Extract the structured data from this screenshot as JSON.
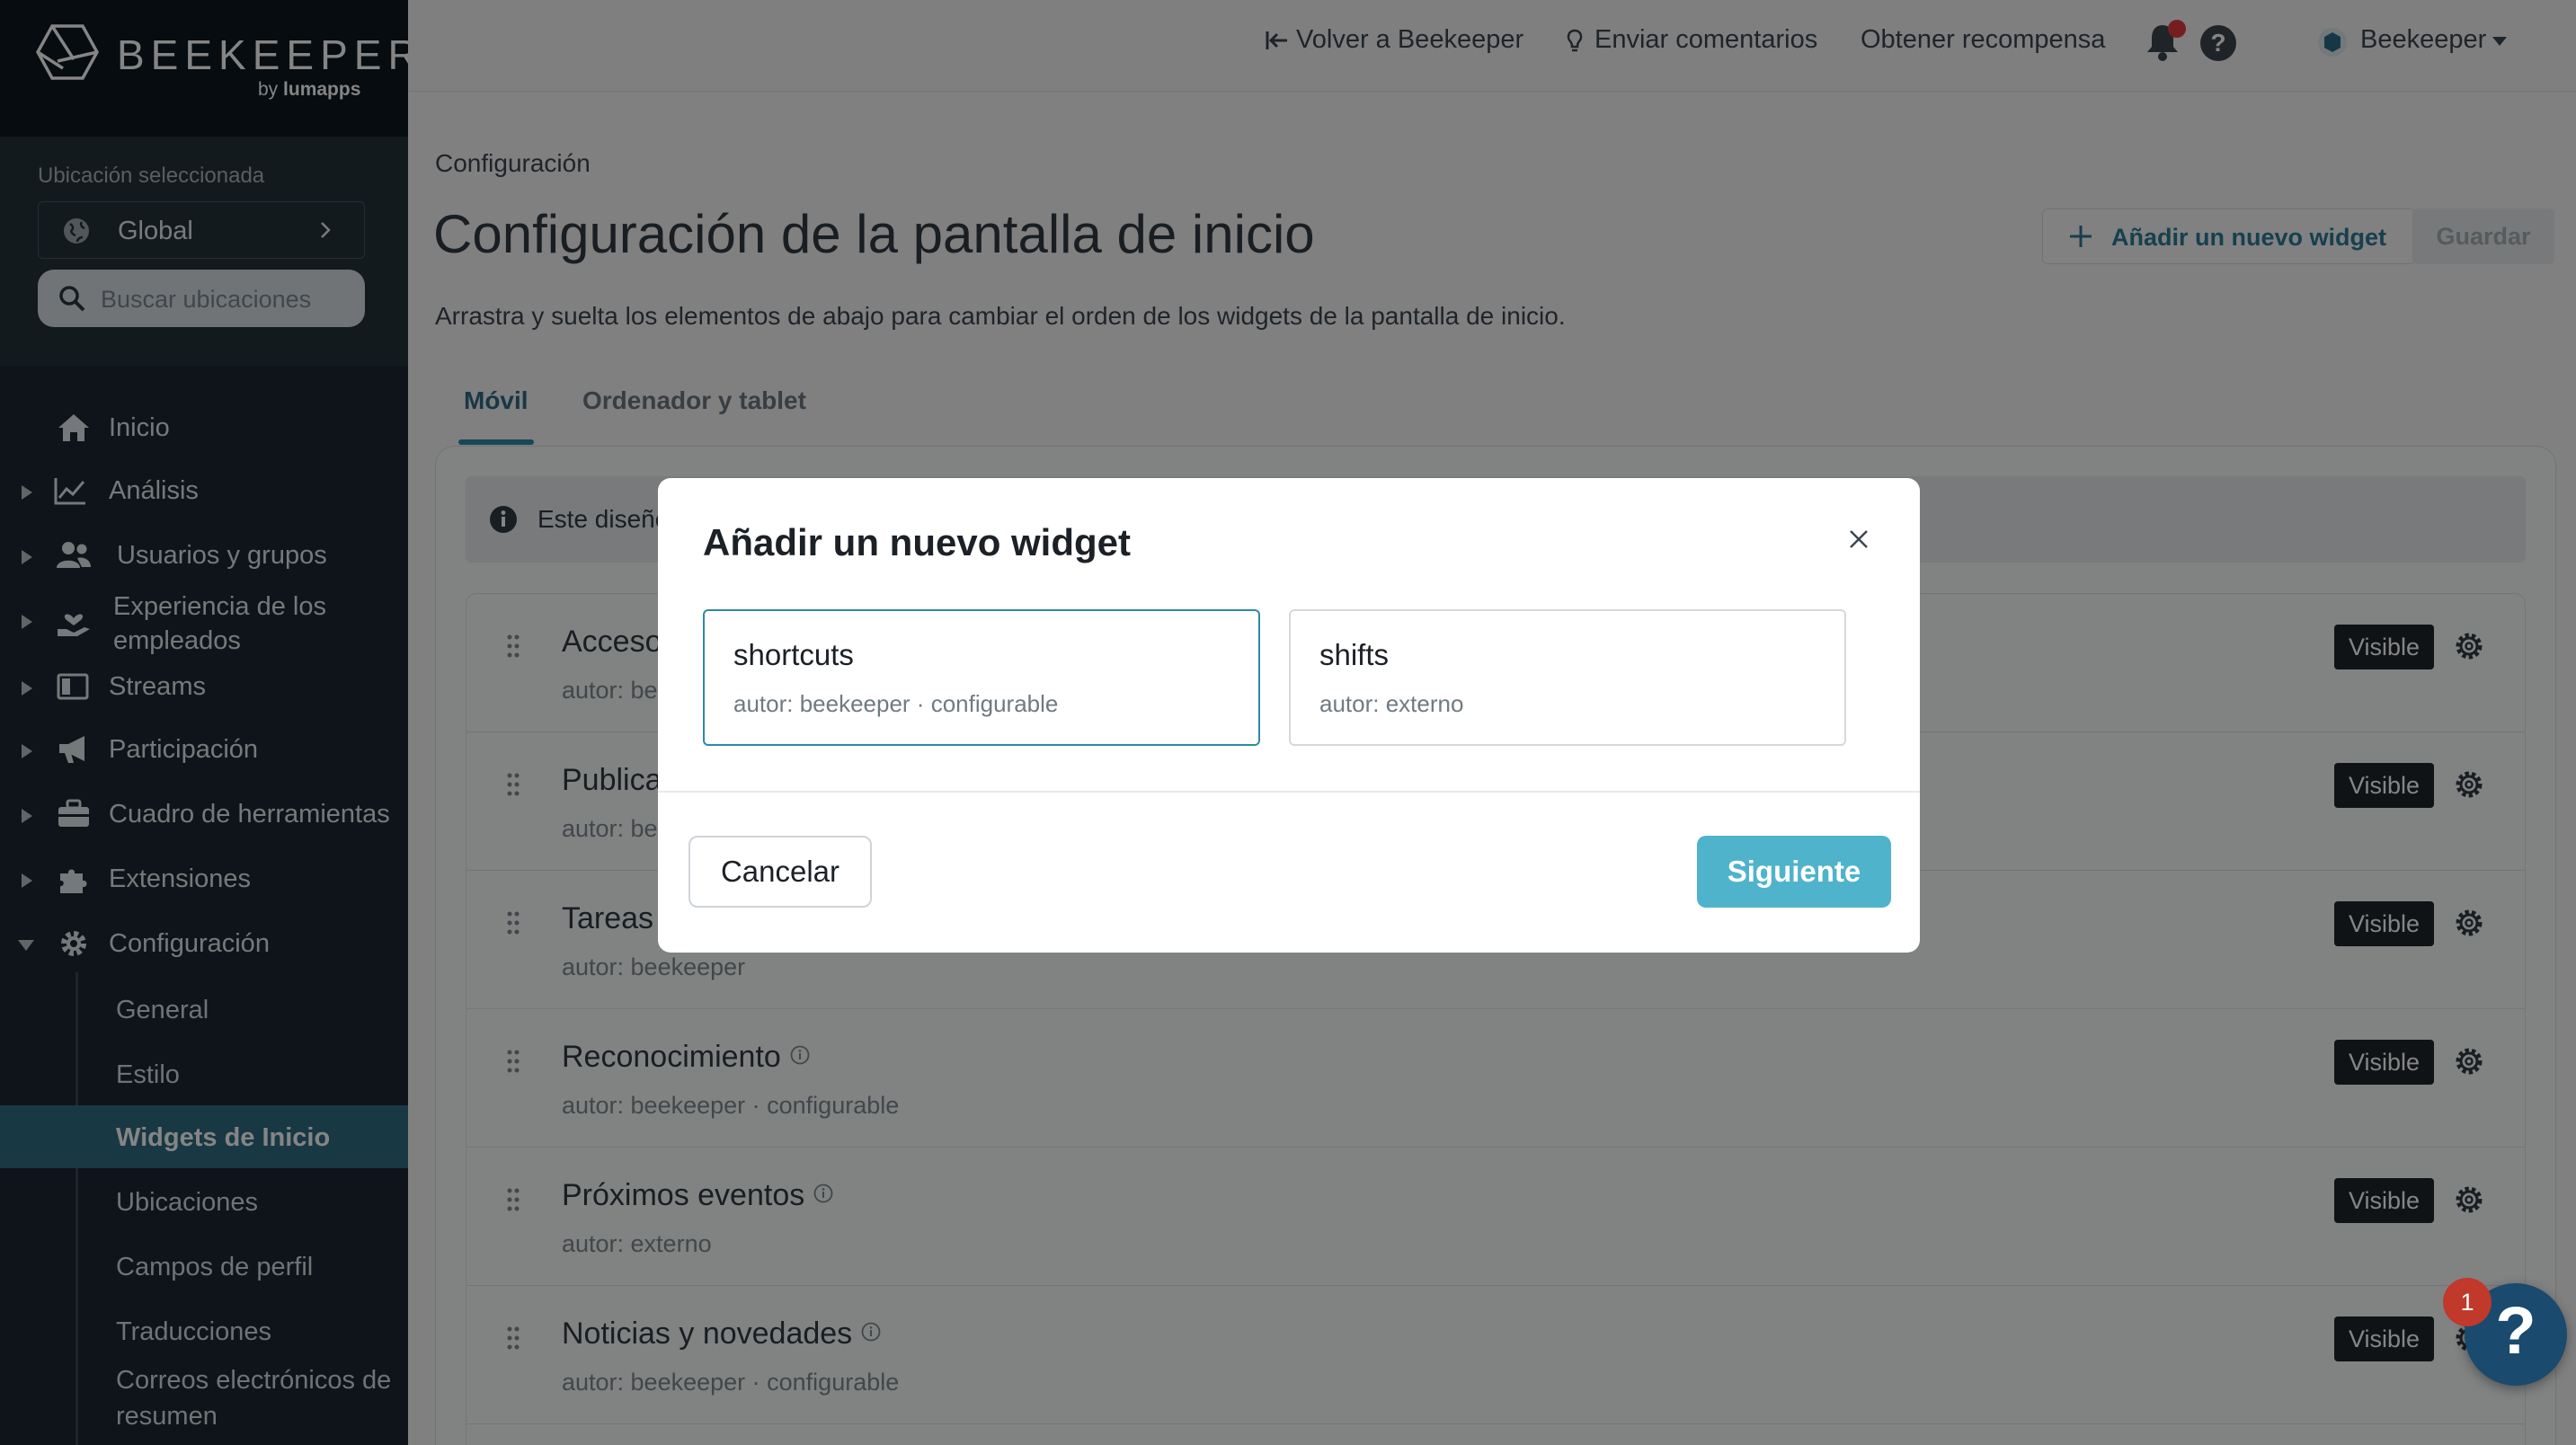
{
  "brand": {
    "name": "BEEKEEPER",
    "by_prefix": "by",
    "by_brand": "lumapps"
  },
  "location": {
    "label": "Ubicación seleccionada",
    "value": "Global",
    "search_placeholder": "Buscar ubicaciones"
  },
  "sidebar": {
    "items": [
      {
        "label": "Inicio",
        "icon": "home-icon",
        "expandable": false
      },
      {
        "label": "Análisis",
        "icon": "chart-line-icon",
        "expandable": true
      },
      {
        "label": "Usuarios y grupos",
        "icon": "users-icon",
        "expandable": true
      },
      {
        "label": "Experiencia de los empleados",
        "icon": "hand-heart-icon",
        "expandable": true
      },
      {
        "label": "Streams",
        "icon": "streams-icon",
        "expandable": true
      },
      {
        "label": "Participación",
        "icon": "megaphone-icon",
        "expandable": true
      },
      {
        "label": "Cuadro de herramientas",
        "icon": "toolbox-icon",
        "expandable": true
      },
      {
        "label": "Extensiones",
        "icon": "puzzle-icon",
        "expandable": true
      },
      {
        "label": "Configuración",
        "icon": "gear-icon",
        "expandable": true,
        "expanded": true
      }
    ],
    "subitems": [
      {
        "label": "General"
      },
      {
        "label": "Estilo"
      },
      {
        "label": "Widgets de Inicio",
        "active": true
      },
      {
        "label": "Ubicaciones"
      },
      {
        "label": "Campos de perfil"
      },
      {
        "label": "Traducciones"
      },
      {
        "label": "Correos electrónicos de resumen"
      }
    ]
  },
  "topbar": {
    "back_link": "Volver a Beekeeper",
    "feedback_link": "Enviar comentarios",
    "reward_link": "Obtener recompensa",
    "account_name": "Beekeeper"
  },
  "page": {
    "breadcrumb": "Configuración",
    "title": "Configuración de la pantalla de inicio",
    "subtitle": "Arrastra y suelta los elementos de abajo para cambiar el orden de los widgets de la pantalla de inicio.",
    "add_widget_label": "Añadir un nuevo widget",
    "save_label": "Guardar",
    "tabs": [
      {
        "label": "Móvil",
        "active": true
      },
      {
        "label": "Ordenador y tablet",
        "active": false
      }
    ],
    "info_text": "Este diseño"
  },
  "widgets": [
    {
      "title": "Acceso",
      "meta": "autor: beekeeper",
      "status": "Visible",
      "has_info": false
    },
    {
      "title": "Publica",
      "meta": "autor: beekeeper",
      "status": "Visible",
      "has_info": false
    },
    {
      "title": "Tareas",
      "meta": "autor: beekeeper",
      "status": "Visible",
      "has_info": false
    },
    {
      "title": "Reconocimiento",
      "meta": "autor: beekeeper · configurable",
      "status": "Visible",
      "has_info": true
    },
    {
      "title": "Próximos eventos",
      "meta": "autor: externo",
      "status": "Visible",
      "has_info": true
    },
    {
      "title": "Noticias y novedades",
      "meta": "autor: beekeeper · configurable",
      "status": "Visible",
      "has_info": true
    }
  ],
  "modal": {
    "title": "Añadir un nuevo widget",
    "options": [
      {
        "name": "shortcuts",
        "meta": "autor: beekeeper · configurable",
        "selected": true
      },
      {
        "name": "shifts",
        "meta": "autor: externo",
        "selected": false
      }
    ],
    "cancel_label": "Cancelar",
    "next_label": "Siguiente"
  },
  "help_widget": {
    "glyph": "?",
    "badge_count": "1"
  },
  "colors": {
    "sidebar_bg": "#1c2830",
    "accent": "#2e8aa6",
    "primary_button": "#4fb3cc",
    "active_nav": "#2e6c80",
    "notification_dot": "#e03a3e"
  }
}
